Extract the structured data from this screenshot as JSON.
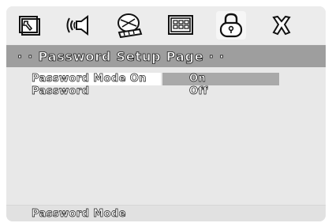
{
  "toolbar": {
    "icons": [
      {
        "name": "general-setup-icon",
        "selected": false
      },
      {
        "name": "audio-setup-icon",
        "selected": false
      },
      {
        "name": "video-setup-icon",
        "selected": false
      },
      {
        "name": "preference-setup-icon",
        "selected": false
      },
      {
        "name": "password-setup-icon",
        "selected": true
      },
      {
        "name": "exit-setup-icon",
        "selected": false
      }
    ]
  },
  "page": {
    "title": "· · Password Setup Page · ·"
  },
  "menu": {
    "items": [
      {
        "label": "Password Mode On",
        "selected": true
      },
      {
        "label": "Password",
        "selected": false
      }
    ],
    "options": [
      "On",
      "Off"
    ],
    "highlighted_option": "On"
  },
  "status": {
    "text": "Password Mode"
  },
  "colors": {
    "screen_bg": "#e8e8e8",
    "title_bar": "#9e9e9e",
    "highlight": "#a9a9a9",
    "text_outline": "#111111"
  }
}
